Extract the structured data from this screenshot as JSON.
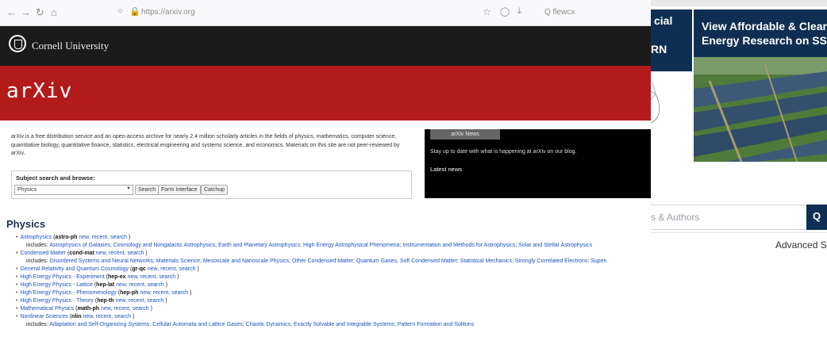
{
  "background_page": {
    "dark_text_1": "cial",
    "dark_text_2": "RN",
    "ad_title_line1": "View Affordable & Clear",
    "ad_title_line2": "Energy Research on SSR",
    "search_placeholder": "s & Authors",
    "search_button_icon": "search-icon",
    "advanced_search_label": "Advanced Sea"
  },
  "browser": {
    "url": "https://arxiv.org",
    "find_placeholder": "Q flewcx",
    "icons": [
      "back-icon",
      "forward-icon",
      "reload-icon",
      "home-icon",
      "tracking-shield-icon",
      "lock-icon",
      "bookmark-star-icon",
      "pocket-icon",
      "download-icon"
    ]
  },
  "header": {
    "institution": "Cornell University",
    "logo_text": "arXiv"
  },
  "intro": {
    "text": "arXiv is a free distribution service and an open-access archive for nearly 2.4 million scholarly articles in the fields of physics, mathematics, computer science, quantitative biology, quantitative finance, statistics, electrical engineering and systems science, and economics. Materials on this site are not peer-reviewed by arXiv."
  },
  "subject_search": {
    "title": "Subject search and browse:",
    "selected": "Physics",
    "buttons": [
      "Search",
      "Form Interface",
      "Catchup"
    ]
  },
  "news": {
    "tab_label": "arXiv News",
    "text": "Stay up to date with what is happening at arXiv on our blog.",
    "latest_label": "Latest news"
  },
  "physics": {
    "title": "Physics",
    "items": [
      {
        "name": "Astrophysics",
        "code": "astro-ph",
        "links": "new, recent, search",
        "includes": "Astrophysics of Galaxies; Cosmology and Nongalactic Astrophysics; Earth and Planetary Astrophysics; High Energy Astrophysical Phenomena; Instrumentation and Methods for Astrophysics; Solar and Stellar Astrophysics"
      },
      {
        "name": "Condensed Matter",
        "code": "cond-mat",
        "links": "new, recent, search",
        "includes": "Disordered Systems and Neural Networks; Materials Science; Mesoscale and Nanoscale Physics; Other Condensed Matter; Quantum Gases; Soft Condensed Matter; Statistical Mechanics; Strongly Correlated Electrons; Supen"
      },
      {
        "name": "General Relativity and Quantum Cosmology",
        "code": "gr-qc",
        "links": "new, recent, search"
      },
      {
        "name": "High Energy Physics - Experiment",
        "code": "hep-ex",
        "links": "new, recent, search"
      },
      {
        "name": "High Energy Physics - Lattice",
        "code": "hep-lat",
        "links": "new, recent, search"
      },
      {
        "name": "High Energy Physics - Phenomenology",
        "code": "hep-ph",
        "links": "new, recent, search"
      },
      {
        "name": "High Energy Physics - Theory",
        "code": "hep-th",
        "links": "new, recent, search"
      },
      {
        "name": "Mathematical Physics",
        "code": "math-ph",
        "links": "new, recent, search"
      },
      {
        "name": "Nonlinear Sciences",
        "code": "nlin",
        "links": "new, recent, search",
        "includes": "Adaptation and Self-Organizing Systems; Cellular Automata and Lattice Gases; Chaotic Dynamics; Exactly Solvable and Integrable Systems; Pattern Formation and Solitons"
      }
    ],
    "includes_prefix": "includes:"
  },
  "colors": {
    "arxiv_red": "#b31b1b",
    "cornell_black": "#1b1b1b",
    "ssrn_navy": "#0f2f52",
    "link_blue": "#1a54b8"
  }
}
